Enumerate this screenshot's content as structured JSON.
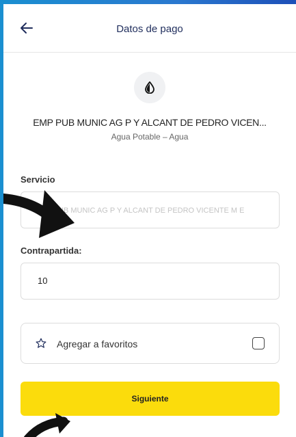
{
  "header": {
    "title": "Datos de pago"
  },
  "company": {
    "name": "EMP PUB MUNIC AG P Y ALCANT DE PEDRO VICEN...",
    "subtitle": "Agua Potable – Agua"
  },
  "form": {
    "service_label": "Servicio",
    "service_value": "EMP PUB MUNIC AG P Y ALCANT DE PEDRO VICENTE M E",
    "counterpart_label": "Contrapartida:",
    "counterpart_value": "10"
  },
  "favorites": {
    "label": "Agregar a favoritos",
    "checked": false
  },
  "actions": {
    "next_label": "Siguiente"
  },
  "colors": {
    "accent": "#fbdc0c",
    "title": "#1f2d5c",
    "frame": "#2a78cf"
  },
  "icons": [
    "back-arrow-icon",
    "water-drop-icon",
    "star-icon",
    "checkbox"
  ]
}
